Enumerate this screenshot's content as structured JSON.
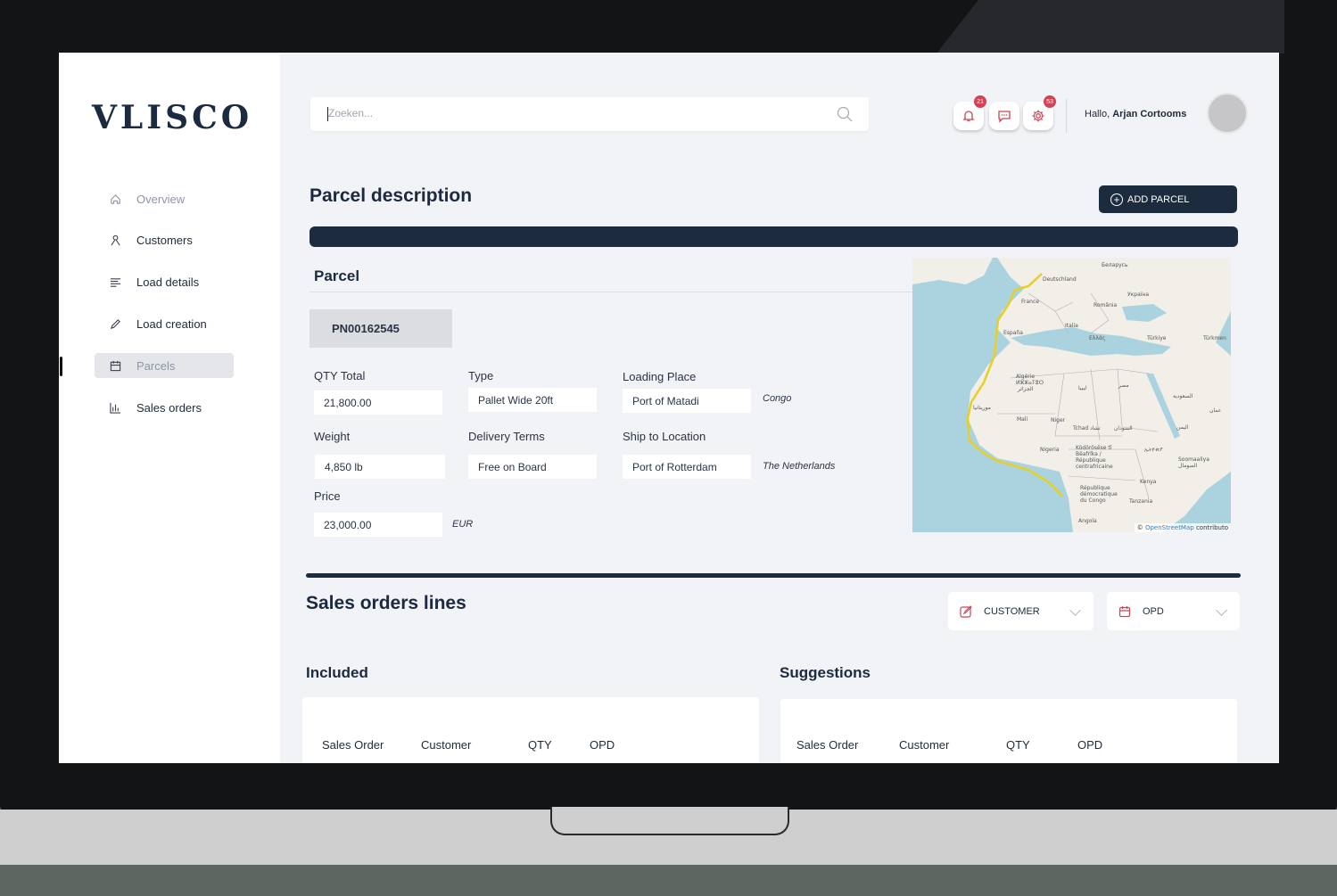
{
  "app": {
    "logo": "VLISCO"
  },
  "sidebar": {
    "items": [
      {
        "label": "Overview",
        "icon": "home-icon"
      },
      {
        "label": "Customers",
        "icon": "customers-icon"
      },
      {
        "label": "Load details",
        "icon": "list-icon"
      },
      {
        "label": "Load creation",
        "icon": "pencil-icon"
      },
      {
        "label": "Parcels",
        "icon": "calendar-icon"
      },
      {
        "label": "Sales orders",
        "icon": "bar-chart-icon"
      }
    ],
    "active": "Parcels"
  },
  "header": {
    "search_placeholder": "Zoeken...",
    "notifications_count": "21",
    "settings_count": "53",
    "greeting_prefix": "Hallo,",
    "user_name": "Arjan Cortooms"
  },
  "page": {
    "title": "Parcel description",
    "add_button": "ADD PARCEL",
    "accent_color": "#1d2b3e",
    "badge_color": "#d14355"
  },
  "parcel": {
    "section_title": "Parcel",
    "id": "PN00162545",
    "qty_total_label": "QTY Total",
    "qty_total": "21,800.00",
    "type_label": "Type",
    "type": "Pallet Wide 20ft",
    "loading_place_label": "Loading Place",
    "loading_place": "Port of Matadi",
    "loading_country": "Congo",
    "weight_label": "Weight",
    "weight": "4,850 lb",
    "delivery_terms_label": "Delivery Terms",
    "delivery_terms": "Free on Board",
    "ship_to_label": "Ship to Location",
    "ship_to": "Port of Rotterdam",
    "ship_to_country": "The Netherlands",
    "price_label": "Price",
    "price": "23,000.00",
    "currency": "EUR"
  },
  "map": {
    "labels": [
      "Беларусь",
      "Deutschland",
      "Україна",
      "France",
      "România",
      "Italia",
      "España",
      "Ελλάς",
      "Türkiye",
      "Türkmen",
      "Algérie",
      "ⵍⵣⵣⴰⵢⴻⵔ",
      "الجزائر",
      "ليبيا",
      "مصر",
      "السعودية",
      "موريتانيا",
      "Mali",
      "Niger",
      "Tchad تشاد",
      "السودان",
      "Nigeria",
      "Ködörösêse tî Bêafrîka / République centrafricaine",
      "ኢትዮጵያ",
      "Soomaaliya الصومال",
      "Kenya",
      "République démocratique du Congo",
      "Tanzania",
      "Angola",
      "اليمن",
      "عمان"
    ],
    "attribution_prefix": "©",
    "attribution_link": "OpenStreetMap",
    "attribution_suffix": "contributo"
  },
  "sales_orders": {
    "title": "Sales orders  lines",
    "filter_customer": "CUSTOMER",
    "filter_opd": "OPD",
    "included_title": "Included",
    "suggestions_title": "Suggestions",
    "columns": [
      "Sales Order",
      "Customer",
      "QTY",
      "OPD"
    ]
  }
}
